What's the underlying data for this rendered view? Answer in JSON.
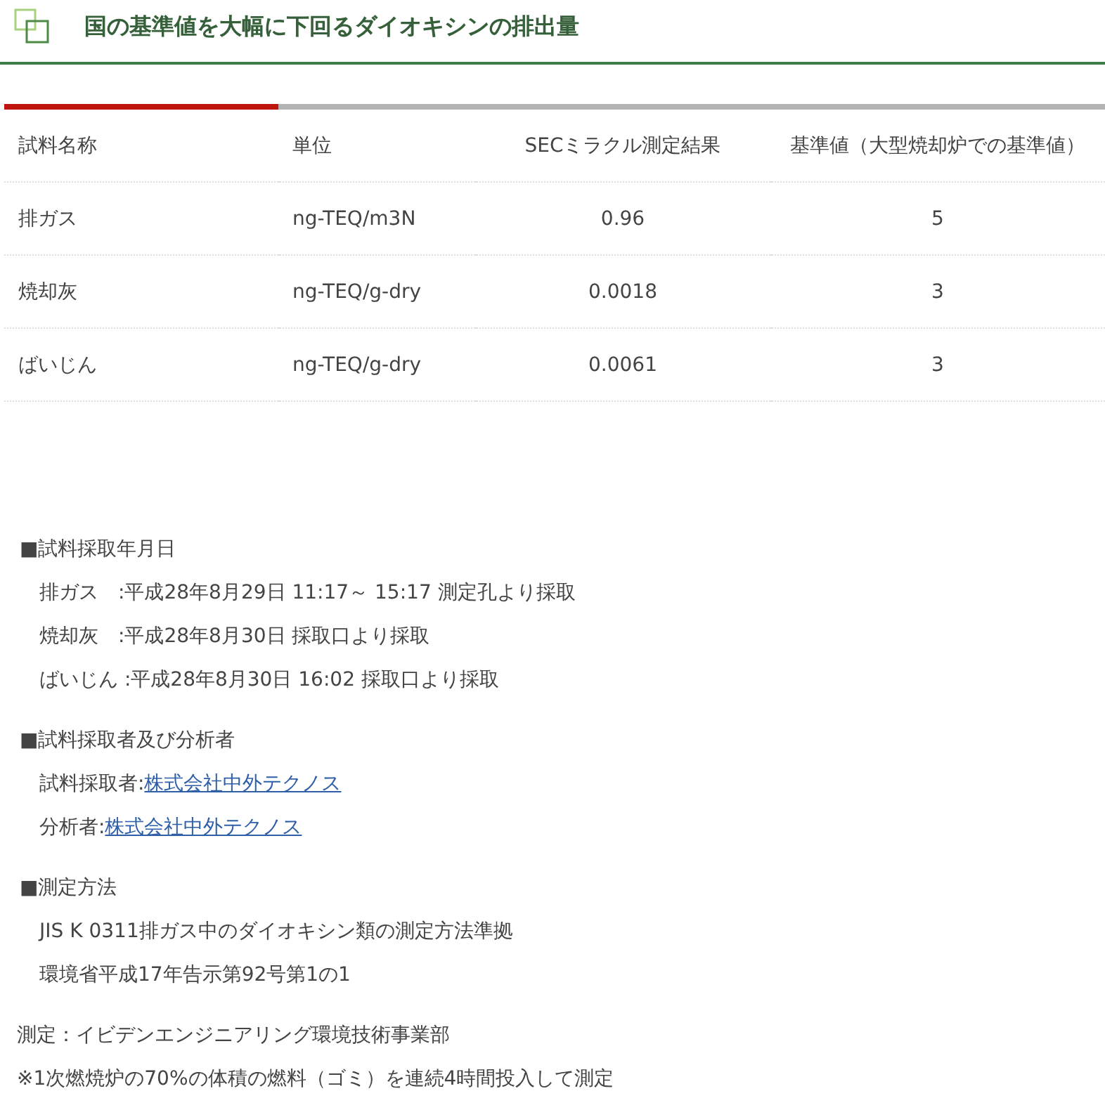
{
  "title": "国の基準値を大幅に下回るダイオキシンの排出量",
  "table": {
    "columns": [
      "試料名称",
      "単位",
      "SECミラクル測定結果",
      "基準値（大型焼却炉での基準値）"
    ],
    "rows": [
      [
        "排ガス",
        "ng-TEQ/m3N",
        "0.96",
        "5"
      ],
      [
        "焼却灰",
        "ng-TEQ/g-dry",
        "0.0018",
        "3"
      ],
      [
        "ばいじん",
        "ng-TEQ/g-dry",
        "0.0061",
        "3"
      ]
    ]
  },
  "sections": [
    {
      "heading": "■試料採取年月日",
      "lines": [
        {
          "kind": "text",
          "text": "排ガス　:平成28年8月29日 11:17～ 15:17 測定孔より採取"
        },
        {
          "kind": "text",
          "text": "焼却灰　:平成28年8月30日 採取口より採取"
        },
        {
          "kind": "text",
          "text": "ばいじん :平成28年8月30日 16:02 採取口より採取"
        }
      ]
    },
    {
      "heading": "■試料採取者及び分析者",
      "lines": [
        {
          "kind": "link",
          "label": "試料採取者:",
          "link": "株式会社中外テクノス"
        },
        {
          "kind": "link",
          "label": "分析者:",
          "link": "株式会社中外テクノス"
        }
      ]
    },
    {
      "heading": "■測定方法",
      "lines": [
        {
          "kind": "text",
          "text": "JIS K 0311排ガス中のダイオキシン類の測定方法準拠"
        },
        {
          "kind": "text",
          "text": "環境省平成17年告示第92号第1の1"
        }
      ]
    }
  ],
  "notes": [
    "測定：イビデンエンジニアリング環境技術事業部",
    "※1次燃焼炉の70%の体積の燃料（ゴミ）を連続4時間投入して測定"
  ]
}
